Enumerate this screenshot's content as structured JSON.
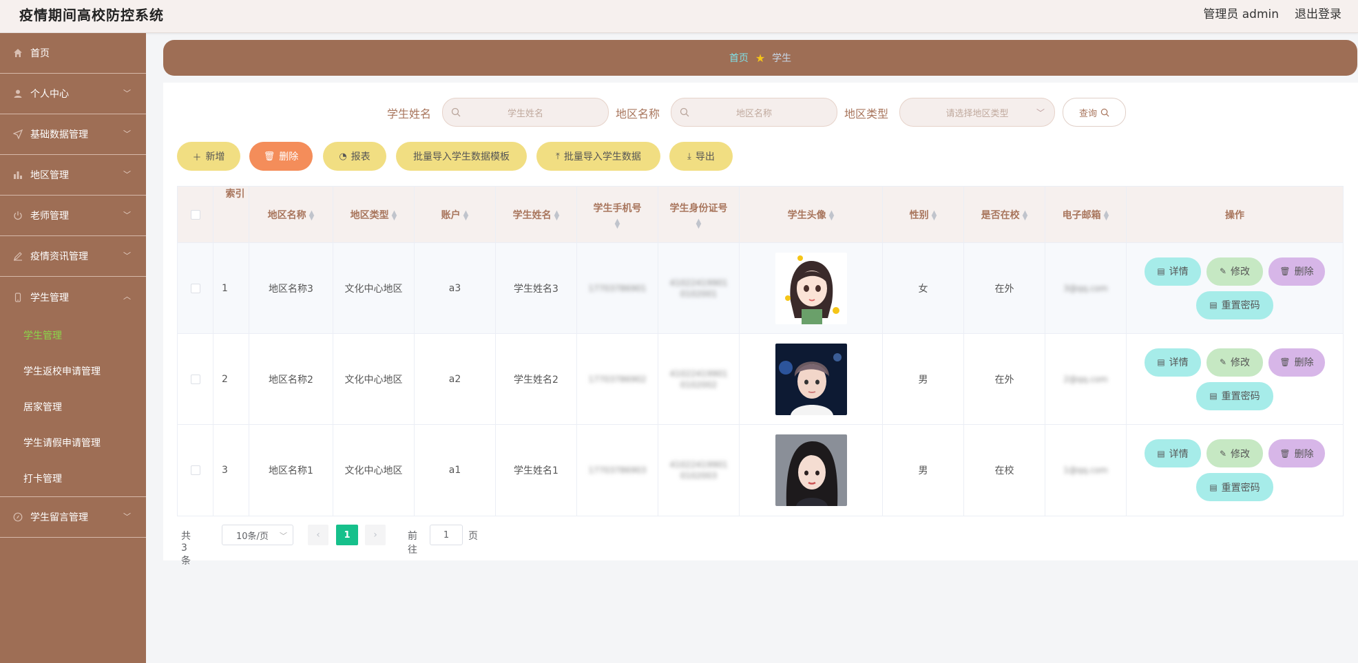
{
  "header": {
    "title": "疫情期间高校防控系统",
    "admin": "管理员 admin",
    "logout": "退出登录"
  },
  "sidebar": {
    "items": [
      {
        "label": "首页",
        "icon": "home-icon"
      },
      {
        "label": "个人中心",
        "icon": "user-icon"
      },
      {
        "label": "基础数据管理",
        "icon": "send-icon"
      },
      {
        "label": "地区管理",
        "icon": "bar-chart-icon"
      },
      {
        "label": "老师管理",
        "icon": "power-icon"
      },
      {
        "label": "疫情资讯管理",
        "icon": "pen-icon"
      },
      {
        "label": "学生管理",
        "icon": "phone-icon"
      },
      {
        "label": "学生留言管理",
        "icon": "compass-icon"
      }
    ],
    "sub_items": [
      "学生管理",
      "学生返校申请管理",
      "居家管理",
      "学生请假申请管理",
      "打卡管理"
    ]
  },
  "breadcrumb": {
    "home": "首页",
    "current": "学生"
  },
  "search": {
    "name_label": "学生姓名",
    "name_placeholder": "学生姓名",
    "region_label": "地区名称",
    "region_placeholder": "地区名称",
    "type_label": "地区类型",
    "type_placeholder": "请选择地区类型",
    "query": "查询"
  },
  "toolbar": {
    "add": "新增",
    "delete": "删除",
    "report": "报表",
    "template": "批量导入学生数据模板",
    "import": "批量导入学生数据",
    "export": "导出"
  },
  "table": {
    "headers": {
      "index": "索引",
      "region": "地区名称",
      "type": "地区类型",
      "account": "账户",
      "name": "学生姓名",
      "phone": "学生手机号",
      "idcard": "学生身份证号",
      "avatar": "学生头像",
      "sex": "性别",
      "inschool": "是否在校",
      "email": "电子邮箱",
      "ops": "操作"
    },
    "rows": [
      {
        "index": "1",
        "region": "地区名称3",
        "type": "文化中心地区",
        "account": "a3",
        "name": "学生姓名3",
        "phone": "17703786901",
        "idcard": "410224199010102001",
        "sex": "女",
        "inschool": "在外",
        "email": "3@qq.com"
      },
      {
        "index": "2",
        "region": "地区名称2",
        "type": "文化中心地区",
        "account": "a2",
        "name": "学生姓名2",
        "phone": "17703786902",
        "idcard": "410224199010102002",
        "sex": "男",
        "inschool": "在外",
        "email": "2@qq.com"
      },
      {
        "index": "3",
        "region": "地区名称1",
        "type": "文化中心地区",
        "account": "a1",
        "name": "学生姓名1",
        "phone": "17703786903",
        "idcard": "410224199010102003",
        "sex": "男",
        "inschool": "在校",
        "email": "1@qq.com"
      }
    ],
    "ops": {
      "detail": "详情",
      "edit": "修改",
      "delete": "删除",
      "reset": "重置密码"
    }
  },
  "pagination": {
    "total": "共 3 条",
    "size": "10条/页",
    "page": "1",
    "goto": "前往",
    "goto_value": "1",
    "page_unit": "页"
  }
}
